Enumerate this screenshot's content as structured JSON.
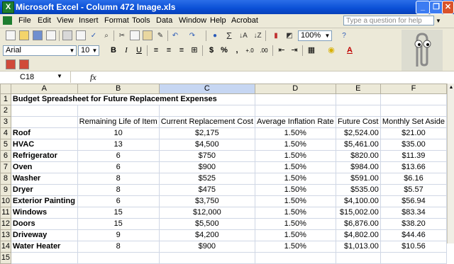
{
  "window": {
    "title": "Microsoft Excel - Column 472 Image.xls",
    "app_icon": "X"
  },
  "menu": [
    "File",
    "Edit",
    "View",
    "Insert",
    "Format",
    "Tools",
    "Data",
    "Window",
    "Help",
    "Acrobat"
  ],
  "help_placeholder": "Type a question for help",
  "toolbar": {
    "zoom": "100%",
    "font": "Arial",
    "size": "10"
  },
  "formula_bar": {
    "cell_ref": "C18",
    "fx_label": "fx"
  },
  "columns": [
    "A",
    "B",
    "C",
    "D",
    "E",
    "F"
  ],
  "rows": [
    {
      "n": "1",
      "cells": [
        "Budget Spreadsheet for Future Replacement Expenses",
        "",
        "",
        "",
        "",
        ""
      ]
    },
    {
      "n": "2",
      "cells": [
        "",
        "",
        "",
        "",
        "",
        ""
      ]
    },
    {
      "n": "3",
      "cells": [
        "",
        "Remaining Life of Item",
        "Current Replacement Cost",
        "Average Inflation Rate",
        "Future Cost",
        "Monthly Set Aside"
      ]
    },
    {
      "n": "4",
      "cells": [
        "Roof",
        "10",
        "$2,175",
        "1.50%",
        "$2,524.00",
        "$21.00"
      ]
    },
    {
      "n": "5",
      "cells": [
        "HVAC",
        "13",
        "$4,500",
        "1.50%",
        "$5,461.00",
        "$35.00"
      ]
    },
    {
      "n": "6",
      "cells": [
        "Refrigerator",
        "6",
        "$750",
        "1.50%",
        "$820.00",
        "$11.39"
      ]
    },
    {
      "n": "7",
      "cells": [
        "Oven",
        "6",
        "$900",
        "1.50%",
        "$984.00",
        "$13.66"
      ]
    },
    {
      "n": "8",
      "cells": [
        "Washer",
        "8",
        "$525",
        "1.50%",
        "$591.00",
        "$6.16"
      ]
    },
    {
      "n": "9",
      "cells": [
        "Dryer",
        "8",
        "$475",
        "1.50%",
        "$535.00",
        "$5.57"
      ]
    },
    {
      "n": "10",
      "cells": [
        "Exterior Painting",
        "6",
        "$3,750",
        "1.50%",
        "$4,100.00",
        "$56.94"
      ]
    },
    {
      "n": "11",
      "cells": [
        "Windows",
        "15",
        "$12,000",
        "1.50%",
        "$15,002.00",
        "$83.34"
      ]
    },
    {
      "n": "12",
      "cells": [
        "Doors",
        "15",
        "$5,500",
        "1.50%",
        "$6,876.00",
        "$38.20"
      ]
    },
    {
      "n": "13",
      "cells": [
        "Driveway",
        "9",
        "$4,200",
        "1.50%",
        "$4,802.00",
        "$44.46"
      ]
    },
    {
      "n": "14",
      "cells": [
        "Water Heater",
        "8",
        "$900",
        "1.50%",
        "$1,013.00",
        "$10.56"
      ]
    },
    {
      "n": "15",
      "cells": [
        "",
        "",
        "",
        "",
        "",
        ""
      ]
    }
  ]
}
